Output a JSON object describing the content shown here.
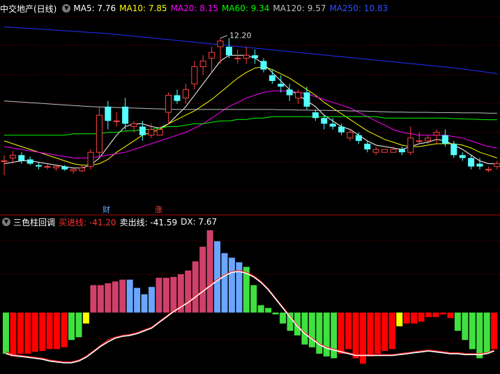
{
  "top_legend": {
    "stock_name": "中交地产(日线)",
    "ma5": {
      "label": "MA5: 7.76",
      "color": "#ffffff"
    },
    "ma10": {
      "label": "MA10: 7.85",
      "color": "#ffff00"
    },
    "ma20": {
      "label": "MA20: 8.15",
      "color": "#ff00ff"
    },
    "ma60": {
      "label": "MA60: 9.34",
      "color": "#00ff00"
    },
    "ma120": {
      "label": "MA120: 9.57",
      "color": "#c0c0c0"
    },
    "ma250": {
      "label": "MA250: 10.83",
      "color": "#0000ff"
    }
  },
  "bottom_legend": {
    "indicator": "三色柱回调",
    "buy_line": {
      "label": "买进线: -41.20",
      "color": "#ff3030"
    },
    "sell_line": {
      "label": "卖出线: -41.59",
      "color": "#ffffff"
    },
    "dx": {
      "label": "DX: 7.67",
      "color": "#ffffff"
    }
  },
  "markers": {
    "fin_label": "财",
    "fin_color": "#66aaff",
    "rise_label": "涨",
    "rise_color": "#ff4040"
  },
  "colors": {
    "up": "#ff4040",
    "down": "#54ffff",
    "bar_pink": "#d0406a",
    "bar_blue": "#6aa6ff",
    "bar_green": "#40e040",
    "bar_red": "#ff0000",
    "bar_yellow": "#ffff00",
    "grid": "#8b0000"
  },
  "chart_data": [
    {
      "type": "candlestick",
      "title": "中交地产(日线)",
      "annotation": "12.20",
      "ylim": [
        6.2,
        13.0
      ],
      "candles": [
        [
          7.9,
          8.1,
          7.4,
          7.9
        ],
        [
          8.0,
          8.25,
          7.8,
          8.1
        ],
        [
          8.1,
          8.2,
          7.8,
          7.9
        ],
        [
          7.95,
          8.05,
          7.75,
          7.8
        ],
        [
          7.75,
          7.85,
          7.6,
          7.7
        ],
        [
          7.7,
          7.8,
          7.6,
          7.7
        ],
        [
          7.65,
          7.75,
          7.55,
          7.7
        ],
        [
          7.7,
          7.75,
          7.55,
          7.6
        ],
        [
          7.55,
          7.65,
          7.45,
          7.6
        ],
        [
          7.55,
          7.75,
          7.5,
          7.65
        ],
        [
          7.7,
          8.3,
          7.6,
          8.2
        ],
        [
          8.2,
          9.8,
          8.0,
          9.5
        ],
        [
          9.8,
          10.0,
          9.0,
          9.3
        ],
        [
          9.3,
          9.6,
          9.1,
          9.3
        ],
        [
          9.8,
          10.1,
          9.0,
          9.2
        ],
        [
          9.1,
          9.3,
          8.9,
          9.2
        ],
        [
          9.1,
          9.3,
          8.6,
          8.8
        ],
        [
          8.8,
          9.2,
          8.7,
          9.0
        ],
        [
          8.8,
          9.1,
          8.8,
          9.0
        ],
        [
          9.6,
          10.3,
          9.2,
          10.2
        ],
        [
          10.2,
          10.4,
          9.9,
          10.0
        ],
        [
          10.1,
          10.6,
          9.9,
          10.4
        ],
        [
          10.6,
          11.4,
          10.4,
          11.2
        ],
        [
          11.2,
          11.6,
          10.9,
          11.4
        ],
        [
          11.5,
          11.9,
          11.0,
          11.7
        ],
        [
          11.9,
          12.2,
          11.3,
          12.1
        ],
        [
          11.9,
          12.2,
          11.5,
          11.6
        ],
        [
          11.5,
          11.8,
          11.3,
          11.5
        ],
        [
          11.5,
          11.9,
          11.3,
          11.6
        ],
        [
          11.6,
          11.8,
          11.3,
          11.5
        ],
        [
          11.4,
          11.5,
          11.0,
          11.1
        ],
        [
          10.9,
          11.1,
          10.6,
          10.7
        ],
        [
          10.6,
          10.9,
          10.3,
          10.5
        ],
        [
          10.4,
          10.6,
          10.0,
          10.2
        ],
        [
          10.1,
          10.4,
          9.9,
          10.3
        ],
        [
          10.3,
          10.5,
          9.7,
          9.8
        ],
        [
          9.6,
          9.7,
          9.3,
          9.4
        ],
        [
          9.4,
          9.5,
          9.0,
          9.2
        ],
        [
          9.2,
          9.4,
          9.0,
          9.1
        ],
        [
          9.1,
          9.2,
          8.8,
          8.9
        ],
        [
          8.7,
          9.0,
          8.6,
          8.9
        ],
        [
          8.8,
          8.9,
          8.5,
          8.6
        ],
        [
          8.5,
          8.6,
          8.2,
          8.3
        ],
        [
          8.2,
          8.4,
          8.1,
          8.3
        ],
        [
          8.2,
          8.3,
          8.2,
          8.3
        ],
        [
          8.2,
          8.4,
          8.2,
          8.3
        ],
        [
          8.3,
          8.4,
          8.1,
          8.2
        ],
        [
          8.2,
          9.1,
          8.1,
          8.7
        ],
        [
          8.6,
          8.9,
          8.5,
          8.6
        ],
        [
          8.6,
          8.8,
          8.5,
          8.7
        ],
        [
          8.8,
          9.0,
          8.5,
          8.9
        ],
        [
          8.8,
          9.0,
          8.4,
          8.5
        ],
        [
          8.5,
          8.6,
          8.0,
          8.1
        ],
        [
          8.1,
          8.2,
          7.9,
          8.0
        ],
        [
          8.0,
          8.1,
          7.6,
          7.7
        ],
        [
          7.8,
          8.0,
          7.6,
          7.7
        ],
        [
          7.6,
          7.7,
          7.5,
          7.6
        ],
        [
          7.7,
          7.9,
          7.6,
          7.8
        ]
      ],
      "series": [
        {
          "name": "MA5",
          "values": [
            7.8,
            7.85,
            7.9,
            7.9,
            7.85,
            7.8,
            7.75,
            7.7,
            7.65,
            7.65,
            7.75,
            8.0,
            8.4,
            8.8,
            9.1,
            9.2,
            9.2,
            9.1,
            9.05,
            9.2,
            9.5,
            9.8,
            10.2,
            10.6,
            11.0,
            11.4,
            11.6,
            11.6,
            11.6,
            11.5,
            11.3,
            11.0,
            10.7,
            10.4,
            10.2,
            10.0,
            9.8,
            9.5,
            9.3,
            9.1,
            9.0,
            8.8,
            8.6,
            8.45,
            8.4,
            8.35,
            8.3,
            8.4,
            8.5,
            8.55,
            8.65,
            8.6,
            8.45,
            8.3,
            8.1,
            7.9,
            7.8,
            7.8
          ]
        },
        {
          "name": "MA10",
          "values": [
            8.6,
            8.5,
            8.4,
            8.3,
            8.2,
            8.1,
            8.0,
            7.9,
            7.8,
            7.75,
            7.75,
            7.8,
            7.95,
            8.2,
            8.4,
            8.6,
            8.8,
            8.9,
            9.0,
            9.2,
            9.35,
            9.5,
            9.65,
            9.85,
            10.05,
            10.3,
            10.55,
            10.8,
            11.0,
            11.15,
            11.2,
            11.1,
            10.95,
            10.8,
            10.6,
            10.4,
            10.2,
            9.95,
            9.75,
            9.55,
            9.35,
            9.15,
            8.95,
            8.8,
            8.65,
            8.55,
            8.45,
            8.4,
            8.4,
            8.45,
            8.5,
            8.5,
            8.5,
            8.45,
            8.35,
            8.2,
            8.1,
            8.0
          ]
        },
        {
          "name": "MA20",
          "values": [
            8.4,
            8.35,
            8.3,
            8.25,
            8.2,
            8.15,
            8.1,
            8.05,
            8.0,
            8.0,
            8.0,
            8.05,
            8.1,
            8.15,
            8.2,
            8.3,
            8.4,
            8.5,
            8.6,
            8.7,
            8.8,
            8.9,
            9.05,
            9.2,
            9.4,
            9.6,
            9.8,
            9.95,
            10.1,
            10.2,
            10.3,
            10.35,
            10.35,
            10.35,
            10.3,
            10.25,
            10.15,
            10.05,
            9.95,
            9.85,
            9.75,
            9.6,
            9.45,
            9.3,
            9.15,
            9.0,
            8.9,
            8.85,
            8.8,
            8.8,
            8.8,
            8.8,
            8.75,
            8.7,
            8.6,
            8.5,
            8.4,
            8.35
          ]
        },
        {
          "name": "MA60",
          "values": [
            8.8,
            8.8,
            8.8,
            8.8,
            8.8,
            8.8,
            8.8,
            8.8,
            8.85,
            8.85,
            8.85,
            8.85,
            8.9,
            8.9,
            8.95,
            8.95,
            9.0,
            9.0,
            9.05,
            9.1,
            9.1,
            9.15,
            9.2,
            9.2,
            9.25,
            9.3,
            9.3,
            9.35,
            9.35,
            9.4,
            9.4,
            9.45,
            9.45,
            9.45,
            9.45,
            9.45,
            9.45,
            9.45,
            9.45,
            9.45,
            9.45,
            9.45,
            9.45,
            9.45,
            9.4,
            9.4,
            9.4,
            9.4,
            9.4,
            9.4,
            9.4,
            9.4,
            9.38,
            9.37,
            9.36,
            9.35,
            9.34,
            9.34
          ]
        },
        {
          "name": "MA120",
          "values": [
            10.0,
            9.98,
            9.96,
            9.94,
            9.92,
            9.9,
            9.88,
            9.86,
            9.84,
            9.82,
            9.8,
            9.79,
            9.78,
            9.77,
            9.76,
            9.75,
            9.74,
            9.73,
            9.72,
            9.71,
            9.7,
            9.7,
            9.7,
            9.7,
            9.7,
            9.7,
            9.7,
            9.7,
            9.7,
            9.7,
            9.7,
            9.7,
            9.69,
            9.69,
            9.68,
            9.68,
            9.67,
            9.67,
            9.66,
            9.66,
            9.65,
            9.65,
            9.64,
            9.63,
            9.62,
            9.61,
            9.61,
            9.6,
            9.6,
            9.6,
            9.59,
            9.59,
            9.59,
            9.58,
            9.58,
            9.58,
            9.57,
            9.57
          ]
        },
        {
          "name": "MA250",
          "values": [
            12.6,
            12.58,
            12.56,
            12.54,
            12.52,
            12.5,
            12.48,
            12.46,
            12.44,
            12.42,
            12.4,
            12.38,
            12.36,
            12.33,
            12.3,
            12.27,
            12.24,
            12.21,
            12.18,
            12.15,
            12.12,
            12.09,
            12.06,
            12.03,
            12.0,
            11.97,
            11.94,
            11.91,
            11.88,
            11.85,
            11.82,
            11.79,
            11.76,
            11.73,
            11.7,
            11.67,
            11.64,
            11.61,
            11.58,
            11.55,
            11.52,
            11.49,
            11.46,
            11.43,
            11.4,
            11.37,
            11.34,
            11.31,
            11.28,
            11.25,
            11.22,
            11.19,
            11.16,
            11.12,
            11.08,
            11.04,
            11.0,
            10.96
          ]
        }
      ]
    },
    {
      "type": "bar",
      "title": "三色柱回调",
      "ylim": [
        -55,
        90
      ],
      "values": [
        -45,
        -48,
        -45,
        -45,
        -43,
        -42,
        -40,
        -40,
        -38,
        -30,
        -27,
        -12,
        30,
        30,
        32,
        34,
        36,
        36,
        27,
        20,
        28,
        38,
        38,
        39,
        42,
        46,
        56,
        72,
        90,
        78,
        65,
        60,
        55,
        50,
        30,
        8,
        5,
        -2,
        -12,
        -20,
        -25,
        -35,
        -38,
        -45,
        -48,
        -50,
        -45,
        -40,
        -50,
        -56,
        -48,
        -45,
        -42,
        -40,
        -15,
        -12,
        -12,
        -10,
        -5,
        -5,
        -2,
        -6,
        -20,
        -30,
        -40,
        -50,
        -45,
        -40
      ],
      "bar_colors": [
        "green",
        "red",
        "red",
        "red",
        "red",
        "red",
        "red",
        "red",
        "red",
        "green",
        "green",
        "yellow",
        "pink",
        "pink",
        "pink",
        "pink",
        "pink",
        "blue",
        "blue",
        "blue",
        "blue",
        "pink",
        "pink",
        "pink",
        "pink",
        "pink",
        "pink",
        "pink",
        "pink",
        "blue",
        "blue",
        "blue",
        "blue",
        "green",
        "green",
        "green",
        "green",
        "green",
        "green",
        "green",
        "green",
        "green",
        "green",
        "green",
        "green",
        "green",
        "red",
        "red",
        "red",
        "red",
        "red",
        "red",
        "red",
        "red",
        "yellow",
        "red",
        "red",
        "red",
        "red",
        "red",
        "red",
        "red",
        "green",
        "green",
        "green",
        "green",
        "green",
        "red"
      ],
      "series": [
        {
          "name": "买进线",
          "values": [
            -43,
            -46,
            -47,
            -48,
            -49,
            -50,
            -52,
            -53,
            -54,
            -54,
            -52,
            -48,
            -42,
            -36,
            -30,
            -27,
            -25,
            -24,
            -22,
            -19,
            -16,
            -10,
            -4,
            2,
            7,
            12,
            18,
            24,
            30,
            36,
            41,
            45,
            46,
            44,
            40,
            34,
            26,
            16,
            6,
            -4,
            -14,
            -22,
            -28,
            -34,
            -38,
            -40,
            -42,
            -44,
            -46,
            -46,
            -46,
            -46,
            -46,
            -46,
            -45,
            -44,
            -43,
            -42,
            -41,
            -42,
            -43,
            -44,
            -44,
            -45,
            -45,
            -45,
            -44,
            -41
          ]
        },
        {
          "name": "卖出线",
          "values": [
            -45,
            -47,
            -48,
            -49,
            -50,
            -51,
            -53,
            -54,
            -55,
            -55,
            -53,
            -49,
            -43,
            -37,
            -32,
            -28,
            -26,
            -25,
            -23,
            -20,
            -17,
            -11,
            -5,
            1,
            6,
            11,
            17,
            23,
            29,
            35,
            40,
            44,
            45,
            43,
            39,
            33,
            25,
            15,
            5,
            -5,
            -15,
            -23,
            -29,
            -35,
            -39,
            -41,
            -43,
            -45,
            -47,
            -47,
            -47,
            -47,
            -47,
            -47,
            -46,
            -45,
            -44,
            -43,
            -42,
            -43,
            -44,
            -45,
            -45,
            -46,
            -46,
            -46,
            -45,
            -42
          ]
        }
      ]
    }
  ]
}
